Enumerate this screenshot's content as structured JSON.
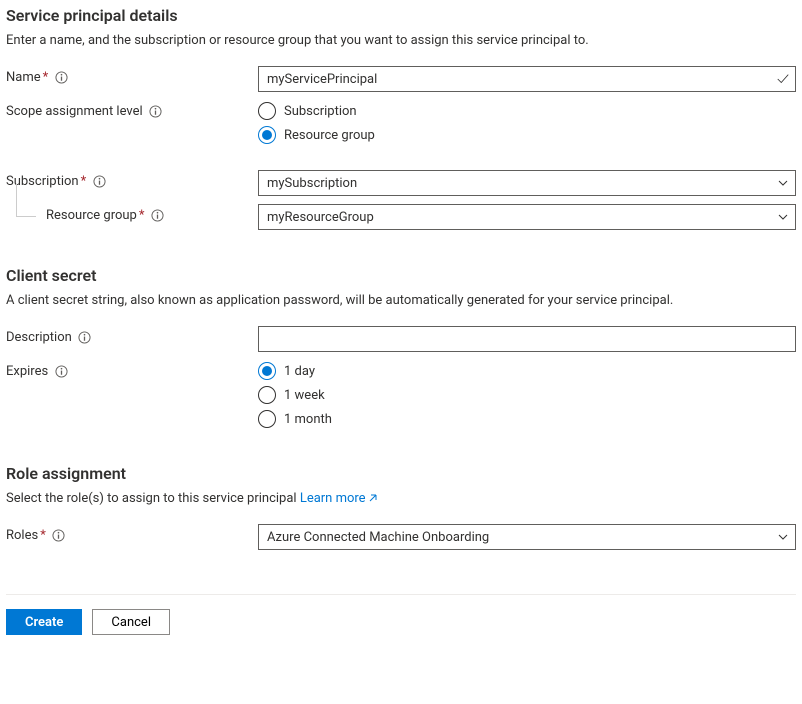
{
  "servicePrincipal": {
    "title": "Service principal details",
    "desc": "Enter a name, and the subscription or resource group that you want to assign this service principal to.",
    "nameLabel": "Name",
    "nameValue": "myServicePrincipal",
    "scopeLabel": "Scope assignment level",
    "scopeOptions": {
      "subscription": "Subscription",
      "resourceGroup": "Resource group"
    },
    "scopeSelected": "resourceGroup",
    "subscriptionLabel": "Subscription",
    "subscriptionValue": "mySubscription",
    "resourceGroupLabel": "Resource group",
    "resourceGroupValue": "myResourceGroup"
  },
  "clientSecret": {
    "title": "Client secret",
    "desc": "A client secret string, also known as application password, will be automatically generated for your service principal.",
    "descriptionLabel": "Description",
    "descriptionValue": "",
    "expiresLabel": "Expires",
    "expiresOptions": {
      "d1": "1 day",
      "w1": "1 week",
      "m1": "1 month"
    },
    "expiresSelected": "d1"
  },
  "roleAssignment": {
    "title": "Role assignment",
    "descPrefix": "Select the role(s) to assign to this service principal ",
    "learnMore": "Learn more",
    "rolesLabel": "Roles",
    "rolesValue": "Azure Connected Machine Onboarding"
  },
  "footer": {
    "create": "Create",
    "cancel": "Cancel"
  }
}
